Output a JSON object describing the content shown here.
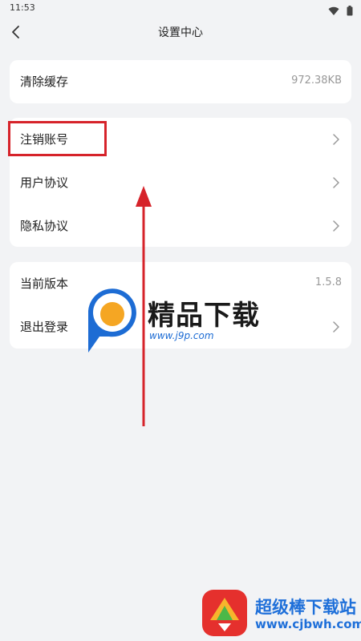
{
  "status_bar": {
    "time": "11:53",
    "icons": [
      "wifi-icon",
      "battery-icon"
    ]
  },
  "header": {
    "title": "设置中心",
    "back_icon": "chevron-left-icon"
  },
  "sections": {
    "cache": {
      "label": "清除缓存",
      "value": "972.38KB"
    },
    "account": [
      {
        "label": "注销账号"
      },
      {
        "label": "用户协议"
      },
      {
        "label": "隐私协议"
      }
    ],
    "app": {
      "version_label": "当前版本",
      "version_value": "1.5.8",
      "logout_label": "退出登录"
    }
  },
  "annotations": {
    "highlight_color": "#d6232a",
    "arrow_color": "#d6232a"
  },
  "watermarks": {
    "center": {
      "title": "精品下载",
      "url": "www.j9p.com"
    },
    "bottom": {
      "title": "超级棒下载站",
      "url": "www.cjbwh.com"
    }
  }
}
